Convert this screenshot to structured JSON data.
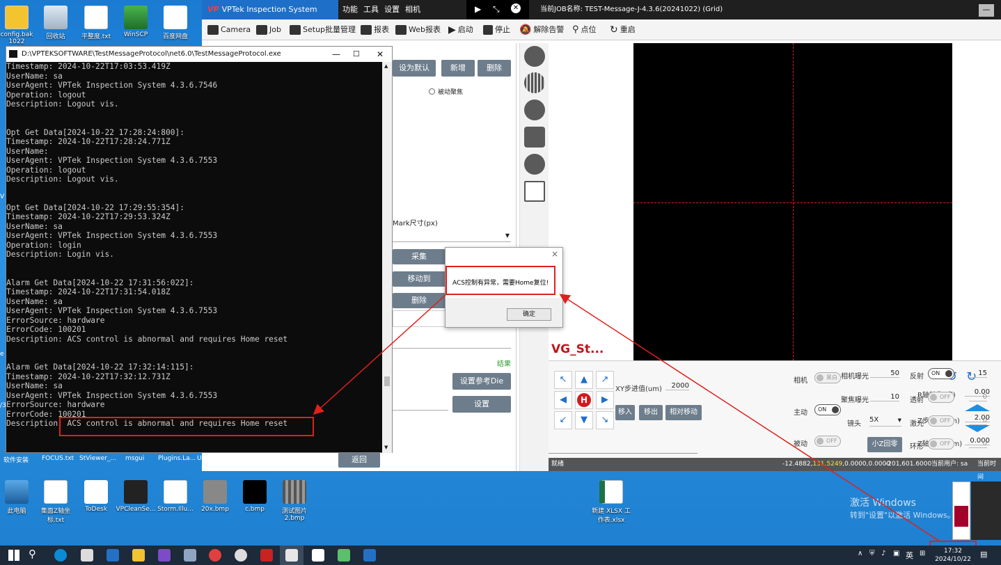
{
  "desktop": {
    "top_icons": [
      "config.bak 1022",
      "回收站",
      "平整度.txt",
      "WinSCP",
      "百度网盘"
    ],
    "bottom_icons": [
      "此电脑",
      "集面Z轴坐标.txt",
      "ToDesk",
      "VPCleanSe...",
      "Storm.Illu...",
      "20x.bmp",
      "c.bmp",
      "测试图片2.bmp",
      "新建 XLSX 工作表.xlsx"
    ],
    "behind_labels": [
      "软件安装",
      "FOCUS.txt",
      "StViewer_...",
      "msgui",
      "Plugins.La...",
      "U"
    ],
    "edge_labels": [
      "V",
      "e",
      "/3"
    ],
    "watermark_line1": "激活 Windows",
    "watermark_line2": "转到\"设置\"以激活 Windows。"
  },
  "app": {
    "title": "VPTek Inspection System 4.3.6.7553",
    "logo": "VP",
    "menus": [
      "功能",
      "工具",
      "设置",
      "相机"
    ],
    "job_title": "当前JOB名称: TEST-Message-J-4.3.6(20241022) (Grid)",
    "toolbar": [
      "Camera",
      "Job",
      "Setup批量管理",
      "报表",
      "Web报表",
      "启动",
      "停止",
      "解除告警",
      "点位",
      "重启"
    ],
    "left": {
      "btn_default": "设为默认",
      "btn_add": "新增",
      "btn_delete": "删除",
      "radio_passive_focus": "被动聚焦",
      "mark_size_label": "Mark尺寸(px)",
      "btn_collect": "采集",
      "btn_move_to": "移动到",
      "btn_delete2": "删除",
      "link_result": "结果",
      "btn_set_ref_die": "设置参考Die",
      "btn_settings": "设置",
      "btn_back": "返回"
    },
    "vg_label": "VG_St...",
    "ctrl": {
      "home_label": "H",
      "xy_step_label": "XY步进值(um)",
      "xy_step_value": "2000",
      "btn_move_in": "移入",
      "btn_move_out": "移出",
      "btn_relative_move": "相对移动",
      "r_angle_label": "R轴转角(度)",
      "r_angle_value": "0.00",
      "z_step_label": "Z步进值(um)",
      "z_step_value": "2.00",
      "z_coord_label": "Z轴坐标(mm)",
      "z_coord_value": "0.000",
      "camera_label": "相机",
      "camera_toggle": "黑白",
      "active_label": "主动",
      "active_toggle": "ON",
      "passive_label": "被动",
      "passive_toggle": "OFF",
      "exposure_label": "相机曝光",
      "exposure_value": "50",
      "focus_exposure_label": "聚焦曝光",
      "focus_exposure_value": "10",
      "lens_label": "镜头",
      "lens_value": "5X",
      "btn_small_z_zero": "小Z回零",
      "reflect_label": "反射",
      "reflect_toggle": "ON",
      "reflect_value": "15",
      "transmit_label": "透射",
      "transmit_toggle": "OFF",
      "transmit_value": "0",
      "laser_label": "激光",
      "laser_toggle": "OFF",
      "laser_value": "0",
      "ring_label": "环形",
      "ring_toggle": "OFF",
      "ring_value": "0"
    },
    "status": {
      "ready": "就绪",
      "coords_a": "-12.4882,",
      "coords_hl": "131.5249",
      "coords_b": ",0.0000,0.0000",
      "coords2": "-201,601.6000",
      "user": "当前用户: sa",
      "time_label": "当前时间"
    }
  },
  "console": {
    "title": "D:\\VPTEKSOFTWARE\\TestMessageProtocol\\net6.0\\TestMessageProtocol.exe",
    "lines": [
      "Timestamp: 2024-10-22T17:03:53.419Z",
      "UserName: sa",
      "UserAgent: VPTek Inspection System 4.3.6.7546",
      "Operation: logout",
      "Description: Logout vis.",
      "",
      "",
      "Opt Get Data[2024-10-22 17:28:24:800]:",
      "Timestamp: 2024-10-22T17:28:24.771Z",
      "UserName:",
      "UserAgent: VPTek Inspection System 4.3.6.7553",
      "Operation: logout",
      "Description: Logout vis.",
      "",
      "",
      "Opt Get Data[2024-10-22 17:29:55:354]:",
      "Timestamp: 2024-10-22T17:29:53.324Z",
      "UserName: sa",
      "UserAgent: VPTek Inspection System 4.3.6.7553",
      "Operation: login",
      "Description: Login vis.",
      "",
      "",
      "Alarm Get Data[2024-10-22 17:31:56:022]:",
      "Timestamp: 2024-10-22T17:31:54.018Z",
      "UserName: sa",
      "UserAgent: VPTek Inspection System 4.3.6.7553",
      "ErrorSource: hardware",
      "ErrorCode: 100201",
      "Description: ACS control is abnormal and requires Home reset",
      "",
      "",
      "Alarm Get Data[2024-10-22 17:32:14:115]:",
      "Timestamp: 2024-10-22T17:32:12.731Z",
      "UserName: sa",
      "UserAgent: VPTek Inspection System 4.3.6.7553",
      "ErrorSource: hardware",
      "ErrorCode: 100201",
      "Description: ACS control is abnormal and requires Home reset"
    ]
  },
  "dialog": {
    "message": "ACS控制有异常，需要Home复位!",
    "ok_label": "确定"
  },
  "taskbar": {
    "ime": "英",
    "time": "17:32",
    "date": "2024/10/22"
  },
  "colors": {
    "annotation_red": "#e0201c",
    "accent_blue": "#1e6fc8"
  }
}
